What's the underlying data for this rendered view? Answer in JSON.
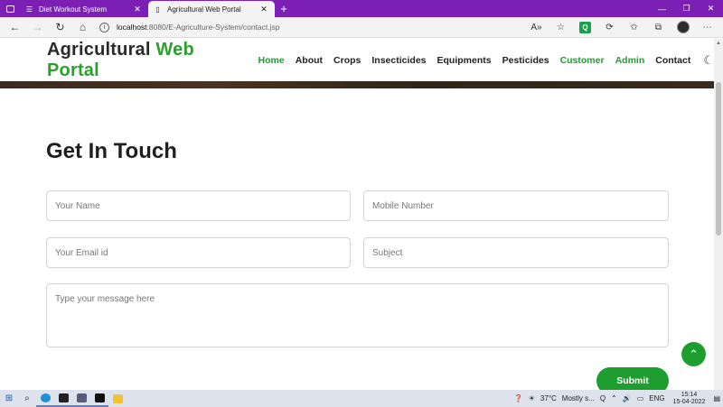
{
  "browser": {
    "tabs": [
      {
        "title": "Diet Workout System",
        "active": false
      },
      {
        "title": "Agricultural Web Portal",
        "active": true
      }
    ],
    "new_tab": "+",
    "url_host": "localhost",
    "url_path": ":8080/E-Agriculture-System/contact.jsp"
  },
  "site": {
    "brand_dark": "Agricultural",
    "brand_green": "Web Portal",
    "nav": [
      {
        "label": "Home",
        "color": "#1e9e2e"
      },
      {
        "label": "About",
        "color": "#222222"
      },
      {
        "label": "Crops",
        "color": "#222222"
      },
      {
        "label": "Insecticides",
        "color": "#222222"
      },
      {
        "label": "Equipments",
        "color": "#222222"
      },
      {
        "label": "Pesticides",
        "color": "#222222"
      },
      {
        "label": "Customer",
        "color": "#1e9e2e"
      },
      {
        "label": "Admin",
        "color": "#1e9e2e"
      },
      {
        "label": "Contact",
        "color": "#222222"
      }
    ]
  },
  "contact": {
    "heading": "Get In Touch",
    "name_placeholder": "Your Name",
    "mobile_placeholder": "Mobile Number",
    "email_placeholder": "Your Email id",
    "subject_placeholder": "Subject",
    "message_placeholder": "Type your message here",
    "submit_label": "Submit"
  },
  "taskbar": {
    "weather_temp": "37°C",
    "weather_text": "Mostly s...",
    "lang": "ENG",
    "time": "15:14",
    "date": "15-04-2022"
  },
  "colors": {
    "accent": "#1e9e2e",
    "tabbar": "#7b1fb5"
  }
}
